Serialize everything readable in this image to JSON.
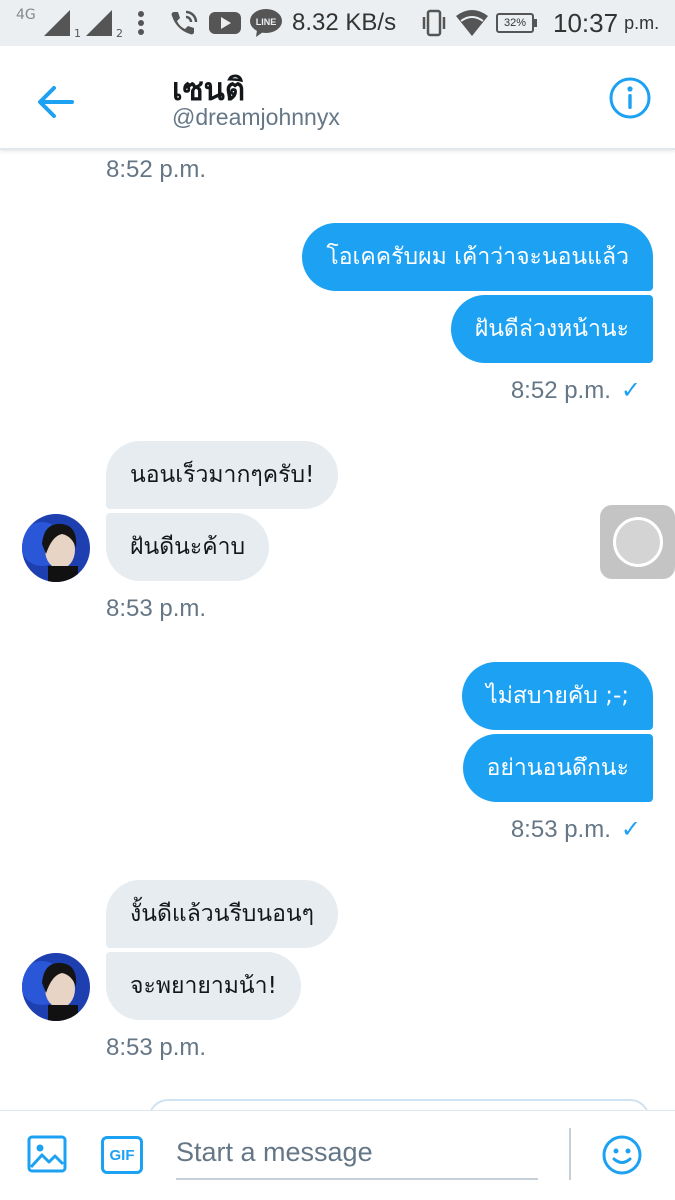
{
  "status_bar": {
    "network_type": "4G",
    "sim1": "1",
    "sim2": "2",
    "net_speed": "8.32 KB/s",
    "battery": "32%",
    "time": "10:37",
    "ampm": "p.m.",
    "line_icon_label": "LINE"
  },
  "header": {
    "title": "เซนติ",
    "handle": "@dreamjohnnyx"
  },
  "top_timestamp": "8:52 p.m.",
  "messages": [
    {
      "dir": "out",
      "text": "โอเคครับผม เค้าว่าจะนอนแล้ว"
    },
    {
      "dir": "out",
      "text": "ฝันดีล่วงหน้านะ"
    },
    {
      "timestamp": "8:52 p.m.",
      "check": "✓"
    },
    {
      "dir": "in",
      "text": "นอนเร็วมากๆครับ!"
    },
    {
      "dir": "in",
      "text": "ฝันดีนะค้าบ"
    },
    {
      "timestamp": "8:53 p.m."
    },
    {
      "dir": "out",
      "text": "ไม่สบายคับ ;-;"
    },
    {
      "dir": "out",
      "text": "อย่านอนดึกนะ"
    },
    {
      "timestamp": "8:53 p.m.",
      "check": "✓"
    },
    {
      "dir": "in",
      "text": "งั้นดีแล้วนรีบนอนๆ"
    },
    {
      "dir": "in",
      "text": "จะพยายามน้า!"
    },
    {
      "timestamp": "8:53 p.m."
    }
  ],
  "composer": {
    "placeholder": "Start a message",
    "gif_label": "GIF"
  },
  "colors": {
    "accent": "#1da1f2",
    "incoming_bubble": "#e6ecf0",
    "muted_text": "#657786"
  }
}
